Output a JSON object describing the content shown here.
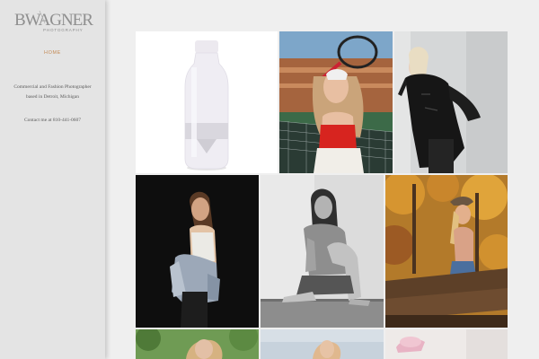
{
  "brand": {
    "logo_text": "BWAGNER",
    "logo_subtext": "PHOTOGRAPHY"
  },
  "nav": {
    "home_label": "HOME"
  },
  "sidebar": {
    "bio": "Commercial and Fashion Photographer based in Detroit, Michigan",
    "contact": "Contact me at 810-441-0607"
  },
  "colors": {
    "accent": "#c48a55",
    "sidebar_bg": "#e4e4e4",
    "page_bg": "#efefef"
  },
  "gallery": {
    "photos": [
      {
        "subject": "product-bottle"
      },
      {
        "subject": "tennis-portrait"
      },
      {
        "subject": "leather-jacket-portrait"
      },
      {
        "subject": "denim-jacket-studio-portrait"
      },
      {
        "subject": "seated-bw-portrait"
      },
      {
        "subject": "autumn-log-portrait"
      },
      {
        "subject": "tree-portrait"
      },
      {
        "subject": "sky-portrait"
      },
      {
        "subject": "pink-hat-portrait"
      }
    ]
  }
}
